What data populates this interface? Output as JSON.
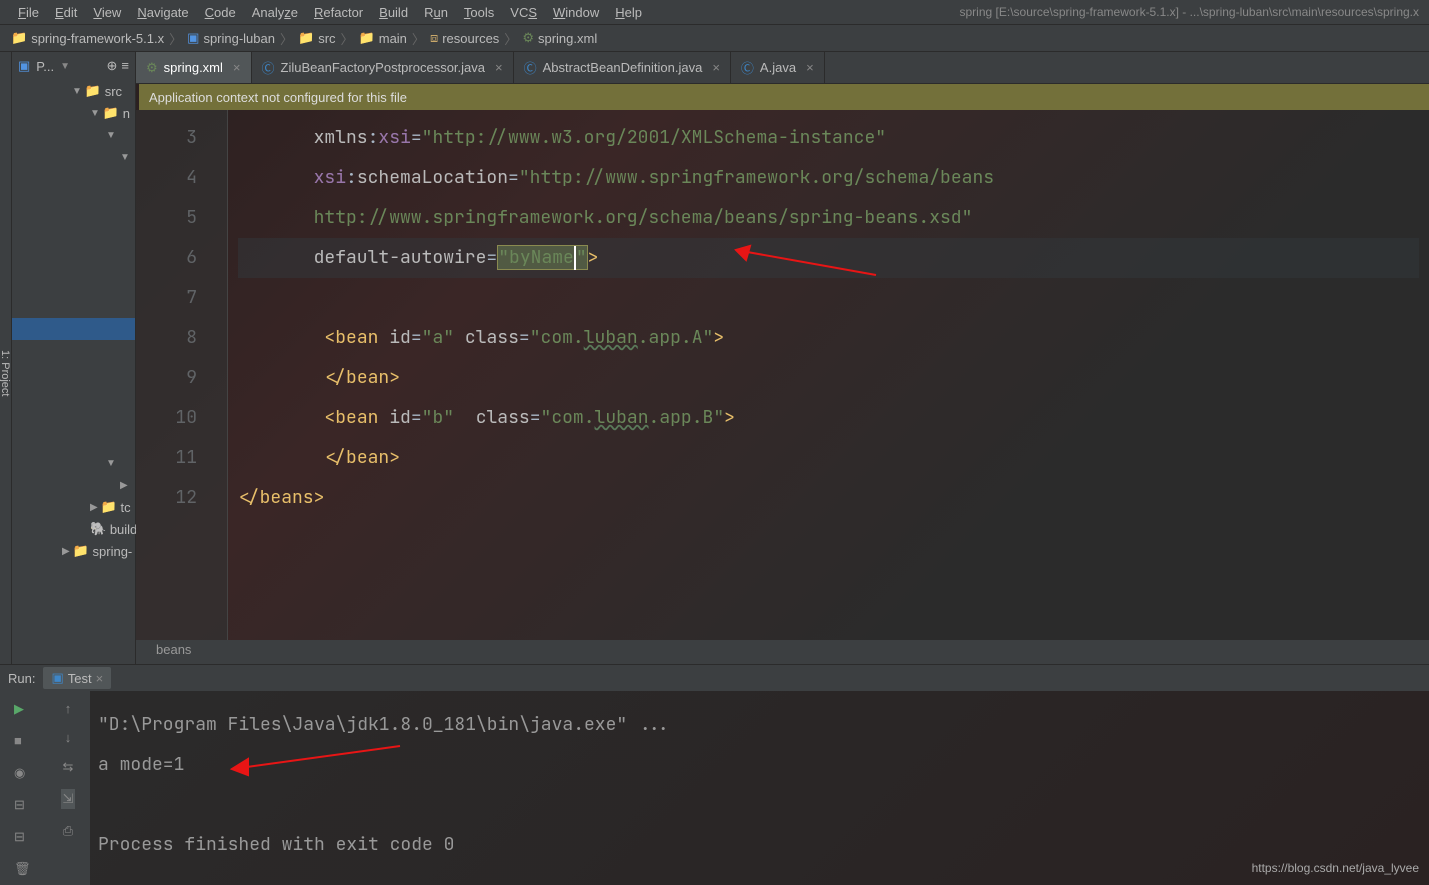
{
  "menu": {
    "file": "File",
    "edit": "Edit",
    "view": "View",
    "navigate": "Navigate",
    "code": "Code",
    "analyze": "Analyze",
    "refactor": "Refactor",
    "build": "Build",
    "run": "Run",
    "tools": "Tools",
    "vcs": "VCS",
    "window": "Window",
    "help": "Help",
    "title": "spring [E:\\source\\spring-framework-5.1.x] - ...\\spring-luban\\src\\main\\resources\\spring.x"
  },
  "breadcrumbs": {
    "c0": "spring-framework-5.1.x",
    "c1": "spring-luban",
    "c2": "src",
    "c3": "main",
    "c4": "resources",
    "c5": "spring.xml"
  },
  "project": {
    "label": "P...",
    "tree": {
      "src": "src",
      "n": "n",
      "tc": "tc",
      "build": "build",
      "spring": "spring-"
    }
  },
  "tabs": {
    "spring": "spring.xml",
    "zilu": "ZiluBeanFactoryPostprocessor.java",
    "abd": "AbstractBeanDefinition.java",
    "a": "A.java"
  },
  "notification": "Application context not configured for this file",
  "lines": {
    "l3": "3",
    "l4": "4",
    "l5": "5",
    "l6": "6",
    "l7": "7",
    "l8": "8",
    "l9": "9",
    "l10": "10",
    "l11": "11",
    "l12": "12"
  },
  "code": {
    "xmlns_xsi_attr": "xmlns",
    "xsi": "xsi",
    "xmlns_xsi_val": "http://www.w3.org/2001/XMLSchema-instance",
    "schema_loc_attr": "schemaLocation",
    "schema_loc_val": "http://www.springframework.org/schema/beans",
    "schema_loc_val2": "http://www.springframework.org/schema/beans/spring-beans.xsd",
    "autowire_attr": "default-autowire",
    "autowire_val": "byName",
    "bean": "bean",
    "close_bean": "/bean",
    "close_beans": "/beans",
    "id_attr": "id",
    "class_attr": "class",
    "id_a": "a",
    "class_a_1": "com.",
    "class_a_2": "luban",
    "class_a_3": ".app.A",
    "id_b": "b",
    "class_b_3": ".app.B",
    "floor": "beans"
  },
  "run": {
    "label": "Run:",
    "test": "Test",
    "line1": "\"D:\\Program Files\\Java\\jdk1.8.0_181\\bin\\java.exe\" ...",
    "line2": "a mode=1",
    "line3": "Process finished with exit code 0"
  },
  "watermark": "https://blog.csdn.net/java_lyvee"
}
